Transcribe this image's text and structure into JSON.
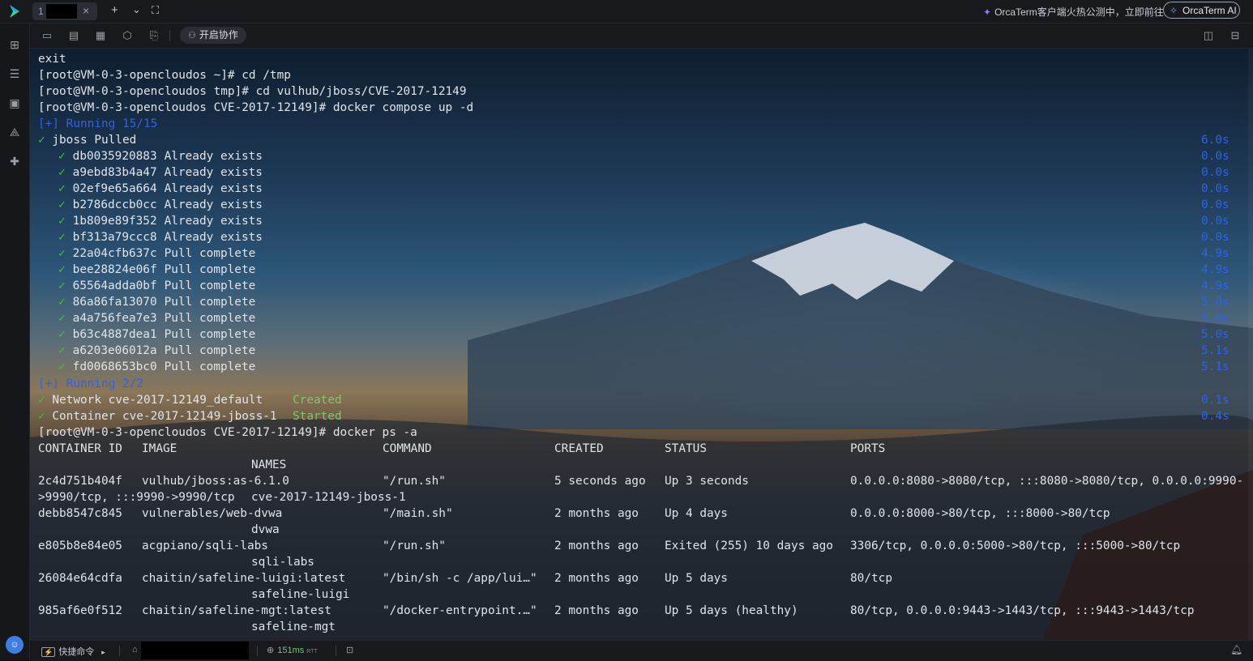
{
  "app": {
    "tab_number": "1",
    "tab_close": "×",
    "new_tab": "+",
    "tab_menu": "⌄",
    "fullscreen": "⛶",
    "promo_text": "OrcaTerm客户端火热公测中，立即前往",
    "ai_button": "OrcaTerm AI"
  },
  "toolbar": {
    "collab_label": "开启协作"
  },
  "terminal": {
    "lines_top": [
      {
        "text": "exit",
        "cls": ""
      },
      {
        "text": "[root@VM-0-3-opencloudos ~]# cd /tmp",
        "cls": ""
      },
      {
        "text": "[root@VM-0-3-opencloudos tmp]# cd vulhub/jboss/CVE-2017-12149",
        "cls": ""
      },
      {
        "text": "[root@VM-0-3-opencloudos CVE-2017-12149]# docker compose up -d",
        "cls": ""
      }
    ],
    "running1": "[+] Running 15/15",
    "pull_header": {
      "check": "✓",
      "text": " jboss Pulled",
      "time": "6.0s"
    },
    "layers": [
      {
        "id": "db0035920883",
        "status": "Already exists",
        "time": "0.0s"
      },
      {
        "id": "a9ebd83b4a47",
        "status": "Already exists",
        "time": "0.0s"
      },
      {
        "id": "02ef9e65a664",
        "status": "Already exists",
        "time": "0.0s"
      },
      {
        "id": "b2786dccb0cc",
        "status": "Already exists",
        "time": "0.0s"
      },
      {
        "id": "1b809e89f352",
        "status": "Already exists",
        "time": "0.0s"
      },
      {
        "id": "bf313a79ccc8",
        "status": "Already exists",
        "time": "0.0s"
      },
      {
        "id": "22a04cfb637c",
        "status": "Pull complete",
        "time": "4.9s"
      },
      {
        "id": "bee28824e06f",
        "status": "Pull complete",
        "time": "4.9s"
      },
      {
        "id": "65564adda0bf",
        "status": "Pull complete",
        "time": "4.9s"
      },
      {
        "id": "86a86fa13070",
        "status": "Pull complete",
        "time": "5.0s"
      },
      {
        "id": "a4a756fea7e3",
        "status": "Pull complete",
        "time": "5.0s"
      },
      {
        "id": "b63c4887dea1",
        "status": "Pull complete",
        "time": "5.0s"
      },
      {
        "id": "a6203e06012a",
        "status": "Pull complete",
        "time": "5.1s"
      },
      {
        "id": "fd0068653bc0",
        "status": "Pull complete",
        "time": "5.1s"
      }
    ],
    "running2": "[+] Running 2/2",
    "create_items": [
      {
        "check": "✓",
        "text": " Network cve-2017-12149_default",
        "state": "Created",
        "time": "0.1s"
      },
      {
        "check": "✓",
        "text": " Container cve-2017-12149-jboss-1",
        "state": "Started",
        "time": "0.4s"
      }
    ],
    "ps_command": "[root@VM-0-3-opencloudos CVE-2017-12149]# docker ps -a",
    "ps_headers": {
      "container_id": "CONTAINER ID",
      "image": "IMAGE",
      "command": "COMMAND",
      "created": "CREATED",
      "status": "STATUS",
      "ports": "PORTS",
      "names": "NAMES"
    },
    "ps_rows": [
      {
        "id": "2c4d751b404f",
        "image": "vulhub/jboss:as-6.1.0",
        "command": "\"/run.sh\"",
        "created": "5 seconds ago",
        "status": "Up 3 seconds",
        "ports": "0.0.0.0:8080->8080/tcp, :::8080->8080/tcp, 0.0.0.0:9990-",
        "ports2": ">9990/tcp, :::9990->9990/tcp",
        "name": "cve-2017-12149-jboss-1"
      },
      {
        "id": "debb8547c845",
        "image": "vulnerables/web-dvwa",
        "command": "\"/main.sh\"",
        "created": "2 months ago",
        "status": "Up 4 days",
        "ports": "0.0.0.0:8000->80/tcp, :::8000->80/tcp",
        "ports2": "",
        "name": "dvwa"
      },
      {
        "id": "e805b8e84e05",
        "image": "acgpiano/sqli-labs",
        "command": "\"/run.sh\"",
        "created": "2 months ago",
        "status": "Exited (255) 10 days ago",
        "ports": "3306/tcp, 0.0.0.0:5000->80/tcp, :::5000->80/tcp",
        "ports2": "",
        "name": "sqli-labs"
      },
      {
        "id": "26084e64cdfa",
        "image": "chaitin/safeline-luigi:latest",
        "command": "\"/bin/sh -c /app/lui…\"",
        "created": "2 months ago",
        "status": "Up 5 days",
        "ports": "80/tcp",
        "ports2": "",
        "name": "safeline-luigi"
      },
      {
        "id": "985af6e0f512",
        "image": "chaitin/safeline-mgt:latest",
        "command": "\"/docker-entrypoint.…\"",
        "created": "2 months ago",
        "status": "Up 5 days (healthy)",
        "ports": "80/tcp, 0.0.0.0:9443->1443/tcp, :::9443->1443/tcp",
        "ports2": "",
        "name": "safeline-mgt"
      }
    ]
  },
  "statusbar": {
    "quick_commands": "快捷命令",
    "quick_arrow": "▸",
    "ping": "151ms",
    "ping_unit": "RTT"
  }
}
